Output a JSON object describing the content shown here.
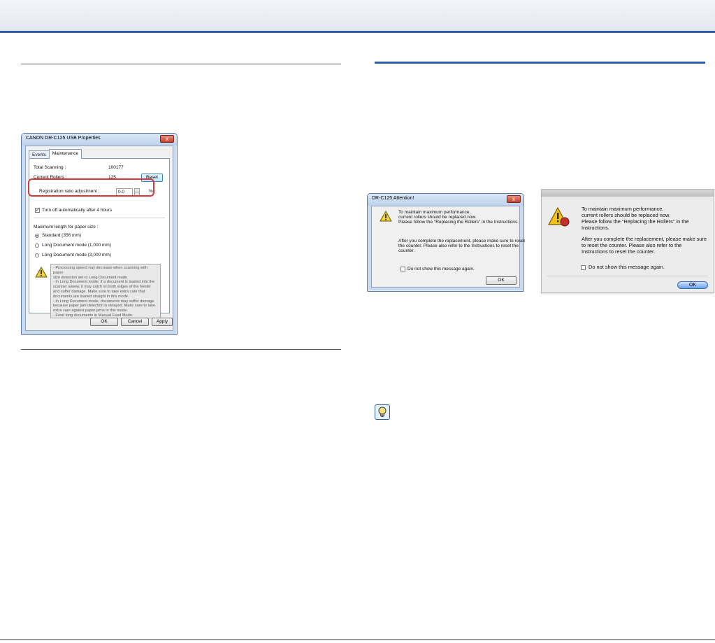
{
  "props_dialog": {
    "title": "CANON DR-C125 USB Properties",
    "close_glyph": "x",
    "tabs": [
      "Events",
      "Maintenance"
    ],
    "total_scanning_label": "Total Scanning :",
    "total_scanning_value": "100177",
    "current_rollers_label": "Current Rollers :",
    "current_rollers_value": "125",
    "reset_label": "Reset",
    "reg_ratio_label": "Registration ratio adjustment :",
    "reg_ratio_value": "0.0",
    "percent": "%",
    "auto_off_label": "Turn off automatically after 4 hours",
    "max_length_label": "Maximum length for paper size :",
    "radio_options": [
      "Standard (356 mm)",
      "Long Document mode (1,000 mm)",
      "Long Document mode (3,000 mm)"
    ],
    "note_lines": [
      "- Processing speed may decrease when scanning with paper",
      "  size detection set to Long Document mode.",
      "- In Long Document mode, if a document is loaded into the",
      "  scanner askew, it may catch on both edges of the feeder",
      "  and suffer damage. Make sure to take extra care that",
      "  documents are loaded straight in this mode.",
      "- In Long Document mode, documents may suffer damage",
      "  because paper jam detection is delayed. Make sure to take",
      "  extra care against paper jams in this mode.",
      "- Feed long documents in Manual Feed Mode."
    ],
    "ok_label": "OK",
    "cancel_label": "Cancel",
    "apply_label": "Apply"
  },
  "win_attention": {
    "title": "DR-C125 Attention!",
    "close_glyph": "x",
    "msg1": "To maintain maximum performance,",
    "msg2": "current rollers should be replaced now.",
    "msg3": "Please follow the \"Replacing the Rollers\" in the Instructions.",
    "msg4": "After you complete the replacement, please make sure to reset",
    "msg5": "the counter. Please also refer to the Instructions to reset the",
    "msg6": "counter.",
    "checkbox_label": "Do not show this message again.",
    "ok_label": "OK"
  },
  "mac_attention": {
    "msg1": "To maintain maximum performance,",
    "msg2": "current rollers should be replaced now.",
    "msg3": "Please follow the \"Replacing the Rollers\" in the",
    "msg4": "Instructions.",
    "msg5": "After you complete the replacement, please make sure",
    "msg6": "to reset the counter. Please also refer to the",
    "msg7": "Instructions to reset the counter.",
    "checkbox_label": "Do not show this message again.",
    "ok_label": "OK"
  },
  "colors": {
    "accent": "#2a5fa6",
    "highlight": "#d43a3a"
  },
  "icons": {
    "warning": "warning-triangle-icon",
    "tip": "lightbulb-icon"
  }
}
